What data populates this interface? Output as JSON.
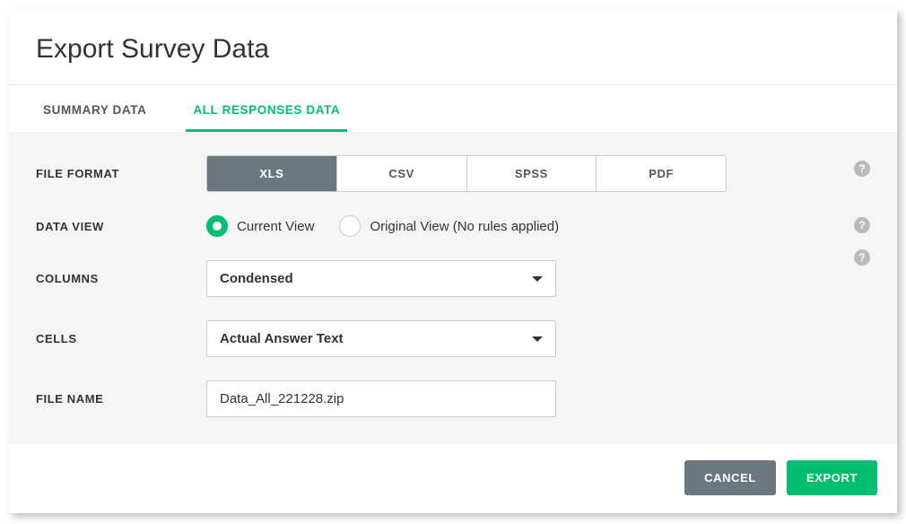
{
  "dialog": {
    "title": "Export Survey Data"
  },
  "tabs": {
    "summary": "SUMMARY DATA",
    "all_responses": "ALL RESPONSES DATA"
  },
  "labels": {
    "file_format": "FILE FORMAT",
    "data_view": "DATA VIEW",
    "columns": "COLUMNS",
    "cells": "CELLS",
    "file_name": "FILE NAME"
  },
  "file_format": {
    "options": [
      "XLS",
      "CSV",
      "SPSS",
      "PDF"
    ],
    "selected": "XLS"
  },
  "data_view": {
    "current": "Current View",
    "original": "Original View (No rules applied)",
    "selected": "current"
  },
  "columns": {
    "selected": "Condensed"
  },
  "cells": {
    "selected": "Actual Answer Text"
  },
  "file_name": {
    "value": "Data_All_221228.zip"
  },
  "buttons": {
    "cancel": "CANCEL",
    "export": "EXPORT"
  },
  "colors": {
    "accent": "#00bf6f",
    "neutral_btn": "#6b787f"
  },
  "help_glyph": "?"
}
